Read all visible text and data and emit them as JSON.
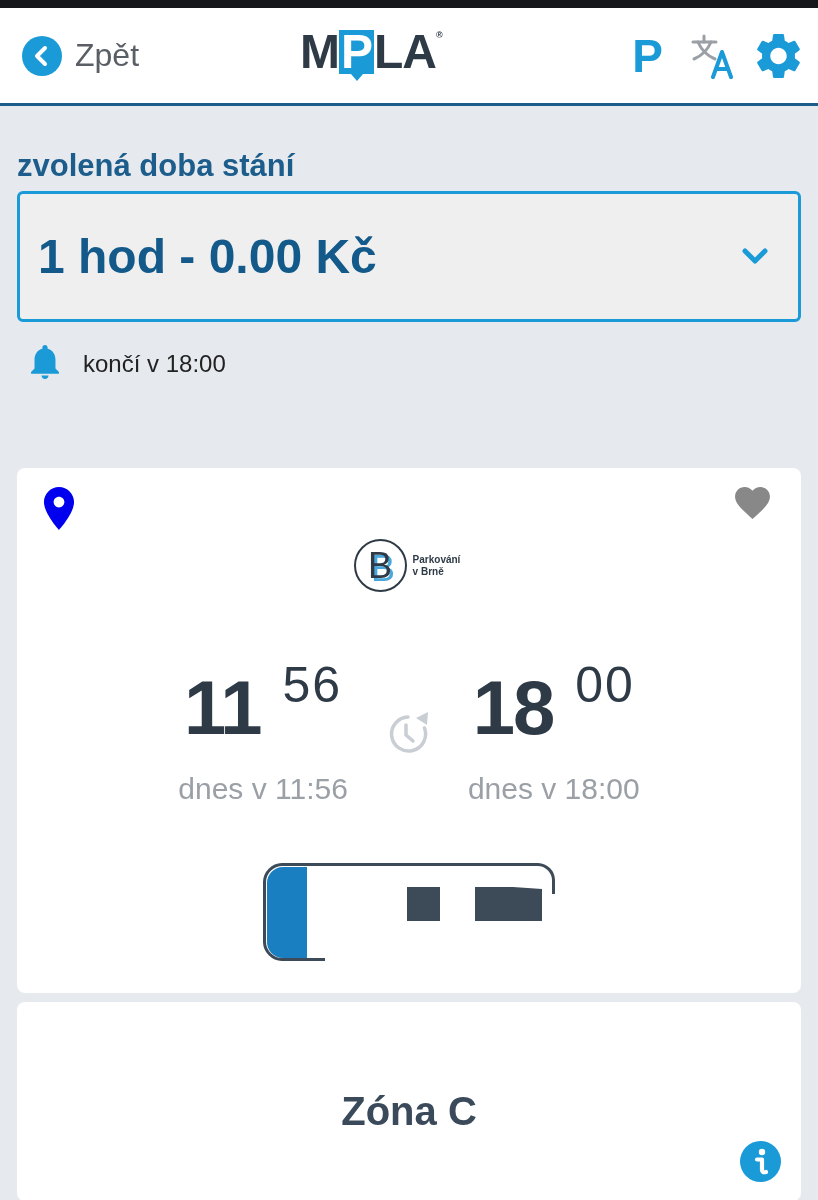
{
  "header": {
    "back_label": "Zpět",
    "logo": [
      {
        "kind": "letters",
        "text": "M"
      },
      {
        "kind": "tile",
        "text": "P"
      },
      {
        "kind": "letters",
        "text": "LA"
      },
      {
        "kind": "mark",
        "text": "®"
      }
    ],
    "parking_button": "P"
  },
  "duration": {
    "label": "zvolená doba stání",
    "value": "1 hod - 0.00 Kč"
  },
  "notice": "končí v 18:00",
  "ticket": {
    "favorite": false,
    "operator": {
      "monogram": "B",
      "name_lines": [
        "Parkování",
        "v Brně"
      ]
    },
    "start": {
      "hours": "11",
      "minutes": "56",
      "caption": "dnes v 11:56"
    },
    "end": {
      "hours": "18",
      "minutes": "00",
      "caption": "dnes v 18:00"
    }
  },
  "zone": {
    "label": "Zóna C"
  }
}
